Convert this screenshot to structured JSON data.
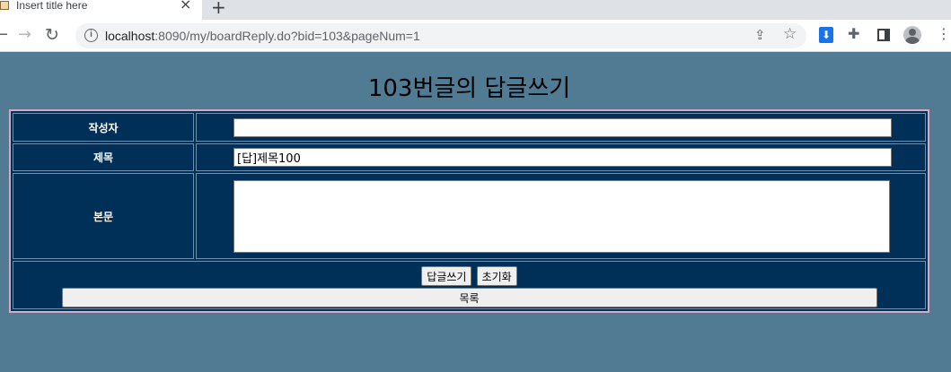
{
  "browser": {
    "tab_title": "Insert title here",
    "tab_close": "×",
    "new_tab": "+",
    "url_host": "localhost",
    "url_rest": ":8090/my/boardReply.do?bid=103&pageNum=1"
  },
  "icons": {
    "back": "←",
    "forward": "→",
    "reload": "↻",
    "info": "i",
    "share": "⇪",
    "star": "☆",
    "download": "⬇",
    "puzzle": "✚",
    "menu": "⋮"
  },
  "page": {
    "title": "103번글의 답글쓰기"
  },
  "form": {
    "writer_label": "작성자",
    "writer_value": "",
    "title_label": "제목",
    "title_value": "[답]제목100",
    "body_label": "본문",
    "body_value": "",
    "submit_label": "답글쓰기",
    "reset_label": "초기화",
    "list_label": "목록"
  },
  "colors": {
    "page_bg": "#517a93",
    "table_bg": "#003057",
    "table_border": "#d9a8c2"
  }
}
